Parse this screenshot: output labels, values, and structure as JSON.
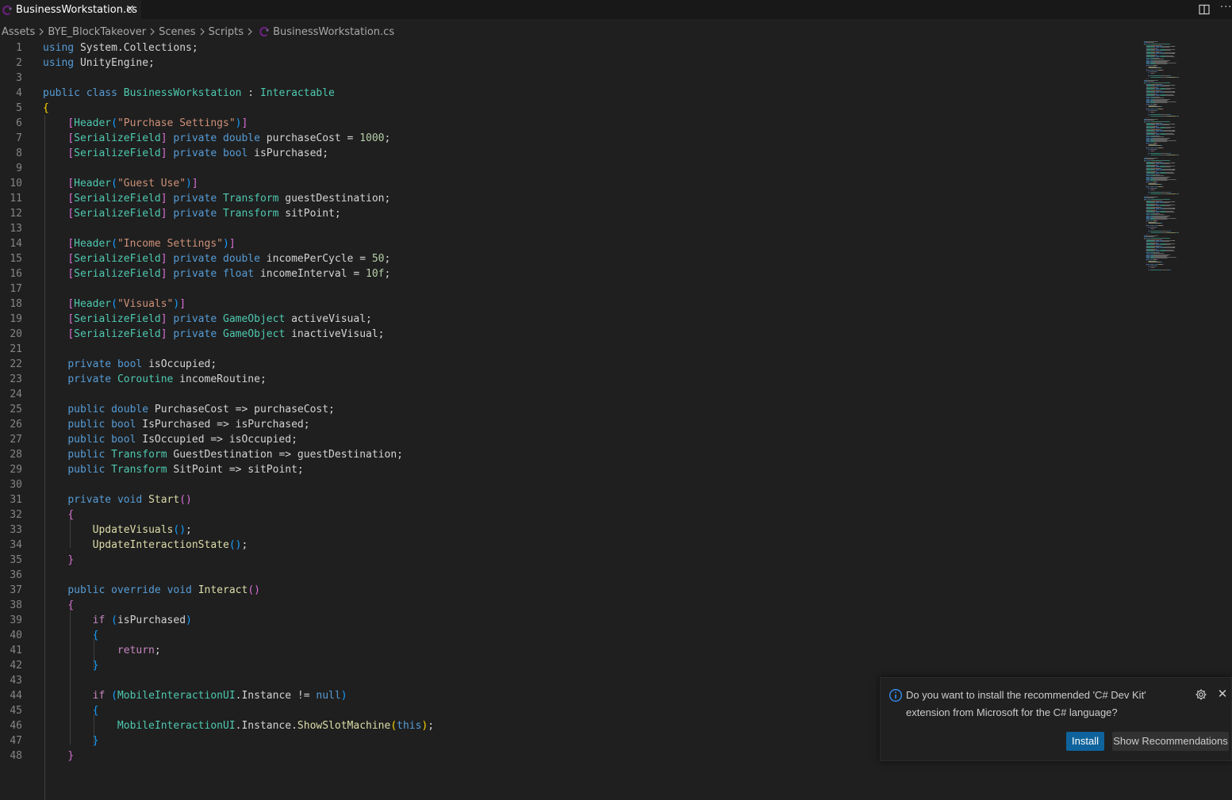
{
  "tab": {
    "label": "BusinessWorkstation.cs",
    "close": "✕"
  },
  "toolbar": {
    "more": "···"
  },
  "breadcrumb": [
    "Assets",
    "BYE_BlockTakeover",
    "Scenes",
    "Scripts",
    "BusinessWorkstation.cs"
  ],
  "colors": {
    "accent": "#0e639c",
    "csharp_icon": "#68217a",
    "background": "#1f1f1f"
  },
  "code_lines": [
    [
      [
        "kw",
        "using"
      ],
      [
        "plain",
        " System.Collections;"
      ]
    ],
    [
      [
        "kw",
        "using"
      ],
      [
        "plain",
        " UnityEngine;"
      ]
    ],
    [],
    [
      [
        "kw",
        "public"
      ],
      [
        "plain",
        " "
      ],
      [
        "kw",
        "class"
      ],
      [
        "plain",
        " "
      ],
      [
        "ty",
        "BusinessWorkstation"
      ],
      [
        "plain",
        " : "
      ],
      [
        "ty",
        "Interactable"
      ]
    ],
    [
      [
        "br1",
        "{"
      ]
    ],
    [
      [
        "plain",
        "    "
      ],
      [
        "br2",
        "["
      ],
      [
        "ty",
        "Header"
      ],
      [
        "br3",
        "("
      ],
      [
        "str",
        "\"Purchase Settings\""
      ],
      [
        "br3",
        ")"
      ],
      [
        "br2",
        "]"
      ]
    ],
    [
      [
        "plain",
        "    "
      ],
      [
        "br2",
        "["
      ],
      [
        "ty",
        "SerializeField"
      ],
      [
        "br2",
        "]"
      ],
      [
        "plain",
        " "
      ],
      [
        "kw",
        "private"
      ],
      [
        "plain",
        " "
      ],
      [
        "kw",
        "double"
      ],
      [
        "plain",
        " purchaseCost = "
      ],
      [
        "num",
        "1000"
      ],
      [
        "plain",
        ";"
      ]
    ],
    [
      [
        "plain",
        "    "
      ],
      [
        "br2",
        "["
      ],
      [
        "ty",
        "SerializeField"
      ],
      [
        "br2",
        "]"
      ],
      [
        "plain",
        " "
      ],
      [
        "kw",
        "private"
      ],
      [
        "plain",
        " "
      ],
      [
        "kw",
        "bool"
      ],
      [
        "plain",
        " isPurchased;"
      ]
    ],
    [],
    [
      [
        "plain",
        "    "
      ],
      [
        "br2",
        "["
      ],
      [
        "ty",
        "Header"
      ],
      [
        "br3",
        "("
      ],
      [
        "str",
        "\"Guest Use\""
      ],
      [
        "br3",
        ")"
      ],
      [
        "br2",
        "]"
      ]
    ],
    [
      [
        "plain",
        "    "
      ],
      [
        "br2",
        "["
      ],
      [
        "ty",
        "SerializeField"
      ],
      [
        "br2",
        "]"
      ],
      [
        "plain",
        " "
      ],
      [
        "kw",
        "private"
      ],
      [
        "plain",
        " "
      ],
      [
        "ty",
        "Transform"
      ],
      [
        "plain",
        " guestDestination;"
      ]
    ],
    [
      [
        "plain",
        "    "
      ],
      [
        "br2",
        "["
      ],
      [
        "ty",
        "SerializeField"
      ],
      [
        "br2",
        "]"
      ],
      [
        "plain",
        " "
      ],
      [
        "kw",
        "private"
      ],
      [
        "plain",
        " "
      ],
      [
        "ty",
        "Transform"
      ],
      [
        "plain",
        " sitPoint;"
      ]
    ],
    [],
    [
      [
        "plain",
        "    "
      ],
      [
        "br2",
        "["
      ],
      [
        "ty",
        "Header"
      ],
      [
        "br3",
        "("
      ],
      [
        "str",
        "\"Income Settings\""
      ],
      [
        "br3",
        ")"
      ],
      [
        "br2",
        "]"
      ]
    ],
    [
      [
        "plain",
        "    "
      ],
      [
        "br2",
        "["
      ],
      [
        "ty",
        "SerializeField"
      ],
      [
        "br2",
        "]"
      ],
      [
        "plain",
        " "
      ],
      [
        "kw",
        "private"
      ],
      [
        "plain",
        " "
      ],
      [
        "kw",
        "double"
      ],
      [
        "plain",
        " incomePerCycle = "
      ],
      [
        "num",
        "50"
      ],
      [
        "plain",
        ";"
      ]
    ],
    [
      [
        "plain",
        "    "
      ],
      [
        "br2",
        "["
      ],
      [
        "ty",
        "SerializeField"
      ],
      [
        "br2",
        "]"
      ],
      [
        "plain",
        " "
      ],
      [
        "kw",
        "private"
      ],
      [
        "plain",
        " "
      ],
      [
        "kw",
        "float"
      ],
      [
        "plain",
        " incomeInterval = "
      ],
      [
        "num",
        "10f"
      ],
      [
        "plain",
        ";"
      ]
    ],
    [],
    [
      [
        "plain",
        "    "
      ],
      [
        "br2",
        "["
      ],
      [
        "ty",
        "Header"
      ],
      [
        "br3",
        "("
      ],
      [
        "str",
        "\"Visuals\""
      ],
      [
        "br3",
        ")"
      ],
      [
        "br2",
        "]"
      ]
    ],
    [
      [
        "plain",
        "    "
      ],
      [
        "br2",
        "["
      ],
      [
        "ty",
        "SerializeField"
      ],
      [
        "br2",
        "]"
      ],
      [
        "plain",
        " "
      ],
      [
        "kw",
        "private"
      ],
      [
        "plain",
        " "
      ],
      [
        "ty",
        "GameObject"
      ],
      [
        "plain",
        " activeVisual;"
      ]
    ],
    [
      [
        "plain",
        "    "
      ],
      [
        "br2",
        "["
      ],
      [
        "ty",
        "SerializeField"
      ],
      [
        "br2",
        "]"
      ],
      [
        "plain",
        " "
      ],
      [
        "kw",
        "private"
      ],
      [
        "plain",
        " "
      ],
      [
        "ty",
        "GameObject"
      ],
      [
        "plain",
        " inactiveVisual;"
      ]
    ],
    [],
    [
      [
        "plain",
        "    "
      ],
      [
        "kw",
        "private"
      ],
      [
        "plain",
        " "
      ],
      [
        "kw",
        "bool"
      ],
      [
        "plain",
        " isOccupied;"
      ]
    ],
    [
      [
        "plain",
        "    "
      ],
      [
        "kw",
        "private"
      ],
      [
        "plain",
        " "
      ],
      [
        "ty",
        "Coroutine"
      ],
      [
        "plain",
        " incomeRoutine;"
      ]
    ],
    [],
    [
      [
        "plain",
        "    "
      ],
      [
        "kw",
        "public"
      ],
      [
        "plain",
        " "
      ],
      [
        "kw",
        "double"
      ],
      [
        "plain",
        " PurchaseCost => purchaseCost;"
      ]
    ],
    [
      [
        "plain",
        "    "
      ],
      [
        "kw",
        "public"
      ],
      [
        "plain",
        " "
      ],
      [
        "kw",
        "bool"
      ],
      [
        "plain",
        " IsPurchased => isPurchased;"
      ]
    ],
    [
      [
        "plain",
        "    "
      ],
      [
        "kw",
        "public"
      ],
      [
        "plain",
        " "
      ],
      [
        "kw",
        "bool"
      ],
      [
        "plain",
        " IsOccupied => isOccupied;"
      ]
    ],
    [
      [
        "plain",
        "    "
      ],
      [
        "kw",
        "public"
      ],
      [
        "plain",
        " "
      ],
      [
        "ty",
        "Transform"
      ],
      [
        "plain",
        " GuestDestination => guestDestination;"
      ]
    ],
    [
      [
        "plain",
        "    "
      ],
      [
        "kw",
        "public"
      ],
      [
        "plain",
        " "
      ],
      [
        "ty",
        "Transform"
      ],
      [
        "plain",
        " SitPoint => sitPoint;"
      ]
    ],
    [],
    [
      [
        "plain",
        "    "
      ],
      [
        "kw",
        "private"
      ],
      [
        "plain",
        " "
      ],
      [
        "kw",
        "void"
      ],
      [
        "plain",
        " "
      ],
      [
        "fn",
        "Start"
      ],
      [
        "br2",
        "()"
      ]
    ],
    [
      [
        "plain",
        "    "
      ],
      [
        "br2",
        "{"
      ]
    ],
    [
      [
        "plain",
        "        "
      ],
      [
        "fn",
        "UpdateVisuals"
      ],
      [
        "br3",
        "()"
      ],
      [
        "plain",
        ";"
      ]
    ],
    [
      [
        "plain",
        "        "
      ],
      [
        "fn",
        "UpdateInteractionState"
      ],
      [
        "br3",
        "()"
      ],
      [
        "plain",
        ";"
      ]
    ],
    [
      [
        "plain",
        "    "
      ],
      [
        "br2",
        "}"
      ]
    ],
    [],
    [
      [
        "plain",
        "    "
      ],
      [
        "kw",
        "public"
      ],
      [
        "plain",
        " "
      ],
      [
        "kw",
        "override"
      ],
      [
        "plain",
        " "
      ],
      [
        "kw",
        "void"
      ],
      [
        "plain",
        " "
      ],
      [
        "fn",
        "Interact"
      ],
      [
        "br2",
        "()"
      ]
    ],
    [
      [
        "plain",
        "    "
      ],
      [
        "br2",
        "{"
      ]
    ],
    [
      [
        "plain",
        "        "
      ],
      [
        "ctl",
        "if"
      ],
      [
        "plain",
        " "
      ],
      [
        "br3",
        "("
      ],
      [
        "plain",
        "isPurchased"
      ],
      [
        "br3",
        ")"
      ]
    ],
    [
      [
        "plain",
        "        "
      ],
      [
        "br3",
        "{"
      ]
    ],
    [
      [
        "plain",
        "            "
      ],
      [
        "ctl",
        "return"
      ],
      [
        "plain",
        ";"
      ]
    ],
    [
      [
        "plain",
        "        "
      ],
      [
        "br3",
        "}"
      ]
    ],
    [],
    [
      [
        "plain",
        "        "
      ],
      [
        "ctl",
        "if"
      ],
      [
        "plain",
        " "
      ],
      [
        "br3",
        "("
      ],
      [
        "ty",
        "MobileInteractionUI"
      ],
      [
        "plain",
        ".Instance != "
      ],
      [
        "kw",
        "null"
      ],
      [
        "br3",
        ")"
      ]
    ],
    [
      [
        "plain",
        "        "
      ],
      [
        "br3",
        "{"
      ]
    ],
    [
      [
        "plain",
        "            "
      ],
      [
        "ty",
        "MobileInteractionUI"
      ],
      [
        "plain",
        ".Instance."
      ],
      [
        "fn",
        "ShowSlotMachine"
      ],
      [
        "br1",
        "("
      ],
      [
        "kw",
        "this"
      ],
      [
        "br1",
        ")"
      ],
      [
        "plain",
        ";"
      ]
    ],
    [
      [
        "plain",
        "        "
      ],
      [
        "br3",
        "}"
      ]
    ],
    [
      [
        "plain",
        "    "
      ],
      [
        "br2",
        "}"
      ]
    ]
  ],
  "notification": {
    "message": "Do you want to install the recommended 'C# Dev Kit' extension from Microsoft for the C# language?",
    "install_label": "Install",
    "recommendations_label": "Show Recommendations",
    "close": "✕"
  }
}
